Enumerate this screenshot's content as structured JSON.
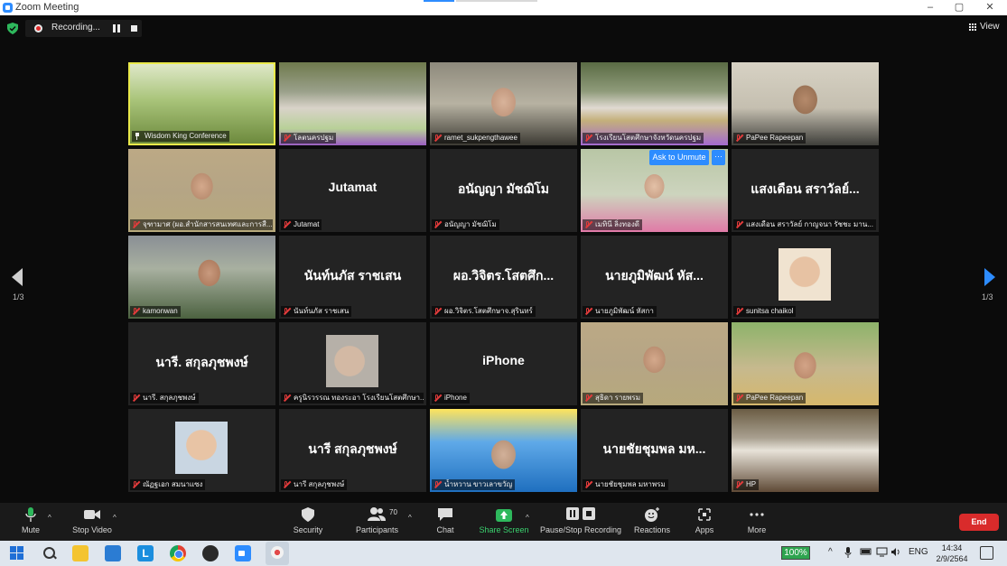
{
  "window": {
    "title": "Zoom Meeting",
    "minimize": "–",
    "maximize": "▢",
    "close": "✕"
  },
  "recording": {
    "label": "Recording..."
  },
  "view_label": "View",
  "pagination": {
    "left": "1/3",
    "right": "1/3"
  },
  "ask_unmute": "Ask to Unmute",
  "more_dots": "···",
  "tiles": [
    {
      "name": "Wisdom King Conference",
      "big": "",
      "video": "v-conf",
      "active": true
    },
    {
      "name": "โลตนครปฐม",
      "big": "",
      "video": "v-room"
    },
    {
      "name": "ramet_sukpengthawee",
      "big": "",
      "video": "v-person"
    },
    {
      "name": "โรงเรียนโสตศึกษาจังหวัดนครปฐม",
      "big": "",
      "video": "v-room2"
    },
    {
      "name": "PaPee Rapeepan",
      "big": "",
      "video": "v-person2"
    },
    {
      "name": "จุฑามาศ (ผอ.สำนักสารสนเทศและการสื...",
      "big": "",
      "video": "v-person5"
    },
    {
      "name": "Jutamat",
      "big": "Jutamat",
      "video": ""
    },
    {
      "name": "อนัญญา มัชฌิโม",
      "big": "อนัญญา มัชฌิโม",
      "video": ""
    },
    {
      "name": "เมทินี ลิ่งทองดี",
      "big": "",
      "video": "v-person4"
    },
    {
      "name": "แสงเดือน สราวัลย์ กาญจนา  รัชชะ มาน...",
      "big": "แสงเดือน สราวัลย์...",
      "video": ""
    },
    {
      "name": "kamonwan",
      "big": "",
      "video": "v-person3"
    },
    {
      "name": "นันท์นภัส  ราชเสน",
      "big": "นันท์นภัส  ราชเสน",
      "video": ""
    },
    {
      "name": "ผอ.วิจิตร.โสตศึกษาจ.สุรินทร์",
      "big": "ผอ.วิจิตร.โสตศึก...",
      "video": ""
    },
    {
      "name": "นายภูมิพัฒน์  หัสกา",
      "big": "นายภูมิพัฒน์  หัส...",
      "video": ""
    },
    {
      "name": "sunitsa chaikol",
      "big": "",
      "video": "",
      "small": "sp-1"
    },
    {
      "name": "นารี. สกุลภุชพงษ์",
      "big": "นารี. สกุลภุชพงษ์",
      "video": ""
    },
    {
      "name": "ครูนิรวรรณ ทองระอา โรงเรียนโสตศึกษา...",
      "big": "",
      "video": "",
      "small": "sp-2"
    },
    {
      "name": "iPhone",
      "big": "iPhone",
      "video": ""
    },
    {
      "name": "สุธิดา รายพรม",
      "big": "",
      "video": "v-person5"
    },
    {
      "name": "PaPee Rapeepan",
      "big": "",
      "video": "v-person6"
    },
    {
      "name": "ณัฏฐเอก สมนาแซง",
      "big": "",
      "video": "",
      "small": "sp-3"
    },
    {
      "name": "นารี สกุลภุชพงษ์",
      "big": "นารี สกุลภุชพงษ์",
      "video": ""
    },
    {
      "name": "น้ำหวาน ขาวเลาขวัญ",
      "big": "",
      "video": "v-person7"
    },
    {
      "name": "นายชัยชุมพล  มหาพรม",
      "big": "นายชัยชุมพล  มห...",
      "video": ""
    },
    {
      "name": "HP",
      "big": "",
      "video": "v-outdoor"
    }
  ],
  "toolbar": {
    "mute": "Mute",
    "stop_video": "Stop Video",
    "security": "Security",
    "participants": "Participants",
    "participants_count": "70",
    "chat": "Chat",
    "share_screen": "Share Screen",
    "pause_stop_recording": "Pause/Stop Recording",
    "reactions": "Reactions",
    "apps": "Apps",
    "more": "More",
    "end": "End"
  },
  "taskbar": {
    "battery": "100%",
    "lang": "ENG",
    "time": "14:34",
    "date": "2/9/2564"
  },
  "colors": {
    "accent": "#2d8cff",
    "end_button": "#d92b2b",
    "share_green": "#2eb85c",
    "active_speaker": "#e9e94a"
  }
}
